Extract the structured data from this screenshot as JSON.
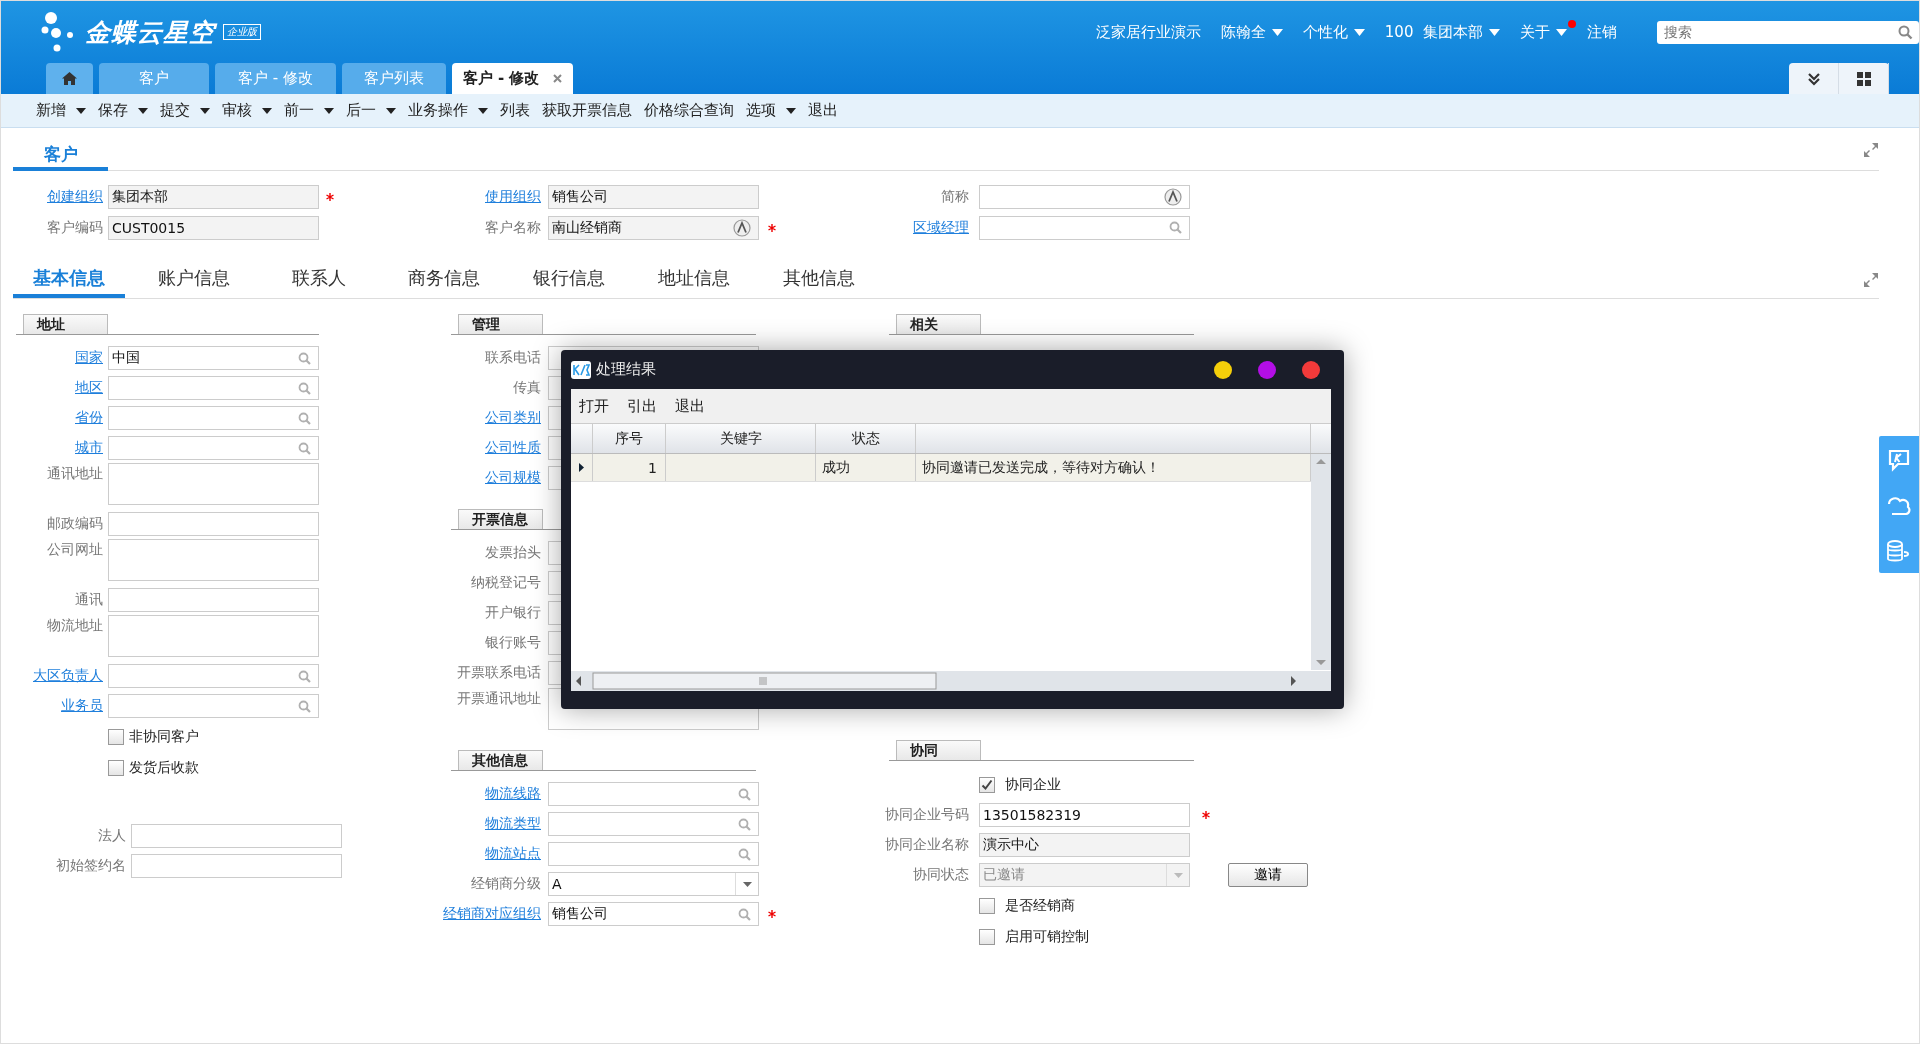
{
  "logo": {
    "name": "金蝶云星空",
    "edition": "企业版"
  },
  "user_menu": [
    {
      "label": "泛家居行业演示",
      "dropdown": false,
      "alert": false
    },
    {
      "label": "陈翰全",
      "dropdown": true,
      "alert": false
    },
    {
      "label": "个性化",
      "dropdown": true,
      "alert": false
    },
    {
      "label": "100  集团本部",
      "dropdown": true,
      "alert": false
    },
    {
      "label": "关于",
      "dropdown": true,
      "alert": true
    },
    {
      "label": "注销",
      "dropdown": false,
      "alert": false
    }
  ],
  "search": {
    "placeholder": "搜索"
  },
  "page_tabs": [
    {
      "kind": "home",
      "selected": false,
      "closable": false
    },
    {
      "kind": "tab",
      "label": "客户",
      "selected": false,
      "closable": false
    },
    {
      "kind": "tab",
      "label": "客户 - 修改",
      "selected": false,
      "closable": false
    },
    {
      "kind": "tab",
      "label": "客户列表",
      "selected": false,
      "closable": false
    },
    {
      "kind": "tab",
      "label": "客户 - 修改",
      "selected": true,
      "closable": true
    }
  ],
  "toolbar": [
    {
      "label": "新增",
      "dropdown": true
    },
    {
      "label": "保存",
      "dropdown": true
    },
    {
      "label": "提交",
      "dropdown": true
    },
    {
      "label": "审核",
      "dropdown": true
    },
    {
      "label": "前一",
      "dropdown": true
    },
    {
      "label": "后一",
      "dropdown": true
    },
    {
      "label": "业务操作",
      "dropdown": true
    },
    {
      "label": "列表",
      "dropdown": false
    },
    {
      "label": "获取开票信息",
      "dropdown": false
    },
    {
      "label": "价格综合查询",
      "dropdown": false
    },
    {
      "label": "选项",
      "dropdown": true
    },
    {
      "label": "退出",
      "dropdown": false
    }
  ],
  "form": {
    "title": "客户"
  },
  "header_fields": [
    [
      {
        "kind": "input",
        "label": "创建组织",
        "link": true,
        "value": "集团本部",
        "lookup": false,
        "multilingual": false,
        "required": true,
        "readonly": true
      },
      {
        "kind": "input",
        "label": "客户编码",
        "link": false,
        "value": "CUST0015",
        "lookup": false,
        "multilingual": false,
        "required": false,
        "readonly": true
      }
    ],
    [
      {
        "kind": "input",
        "label": "使用组织",
        "link": true,
        "value": "销售公司",
        "lookup": false,
        "multilingual": false,
        "required": false,
        "readonly": true
      },
      {
        "kind": "input",
        "label": "客户名称",
        "link": false,
        "value": "南山经销商",
        "lookup": false,
        "multilingual": true,
        "required": true,
        "readonly": true
      }
    ],
    [
      {
        "kind": "input",
        "label": "简称",
        "link": false,
        "lookup": false,
        "multilingual": true,
        "required": false,
        "readonly": false
      },
      {
        "kind": "input",
        "label": "区域经理",
        "link": true,
        "lookup": true,
        "multilingual": false,
        "required": false,
        "readonly": false
      }
    ]
  ],
  "detail_tabs": [
    {
      "label": "基本信息",
      "selected": true
    },
    {
      "label": "账户信息",
      "selected": false
    },
    {
      "label": "联系人",
      "selected": false
    },
    {
      "label": "商务信息",
      "selected": false
    },
    {
      "label": "银行信息",
      "selected": false
    },
    {
      "label": "地址信息",
      "selected": false
    },
    {
      "label": "其他信息",
      "selected": false
    }
  ],
  "columns": [
    [
      {
        "title": "地址",
        "rows": [
          {
            "kind": "input",
            "label": "国家",
            "link": true,
            "value": "中国",
            "lookup": true,
            "multilingual": false,
            "required": false,
            "readonly": false
          },
          {
            "kind": "input",
            "label": "地区",
            "link": true,
            "lookup": true,
            "multilingual": false,
            "required": false,
            "readonly": false
          },
          {
            "kind": "input",
            "label": "省份",
            "link": true,
            "lookup": true,
            "multilingual": false,
            "required": false,
            "readonly": false
          },
          {
            "kind": "input",
            "label": "城市",
            "link": true,
            "lookup": true,
            "multilingual": false,
            "required": false,
            "readonly": false
          },
          {
            "kind": "textarea",
            "label": "通讯地址",
            "link": false,
            "required": false,
            "readonly": false
          },
          {
            "kind": "input",
            "label": "邮政编码",
            "link": false,
            "lookup": false,
            "multilingual": false,
            "required": false,
            "readonly": false
          },
          {
            "kind": "textarea",
            "label": "公司网址",
            "link": false,
            "required": false,
            "readonly": false
          },
          {
            "kind": "input",
            "label": "通讯",
            "link": false,
            "lookup": false,
            "multilingual": false,
            "required": false,
            "readonly": false
          },
          {
            "kind": "textarea",
            "label": "物流地址",
            "link": false,
            "required": false,
            "readonly": false
          },
          {
            "kind": "input",
            "label": "大区负责人",
            "link": true,
            "lookup": true,
            "multilingual": false,
            "required": false,
            "readonly": false
          },
          {
            "kind": "input",
            "label": "业务员",
            "link": true,
            "lookup": true,
            "multilingual": false,
            "required": false,
            "readonly": false
          },
          {
            "kind": "checkbox",
            "label": "非协同客户",
            "checked": false
          },
          {
            "kind": "checkbox",
            "label": "发货后收款",
            "checked": false
          }
        ]
      },
      {
        "rows": [
          {
            "kind": "input",
            "label": "法人",
            "link": false,
            "lookup": false,
            "multilingual": false,
            "required": false,
            "readonly": false
          },
          {
            "kind": "input",
            "label": "初始签约名",
            "link": false,
            "lookup": false,
            "multilingual": false,
            "required": false,
            "readonly": false
          }
        ]
      }
    ],
    [
      {
        "title": "管理",
        "rows": [
          {
            "kind": "input",
            "label": "联系电话",
            "link": false,
            "lookup": false,
            "multilingual": false,
            "required": false,
            "readonly": false
          },
          {
            "kind": "input",
            "label": "传真",
            "link": false,
            "lookup": false,
            "multilingual": false,
            "required": false,
            "readonly": false
          },
          {
            "kind": "input",
            "label": "公司类别",
            "link": true,
            "lookup": false,
            "multilingual": false,
            "required": false,
            "readonly": false
          },
          {
            "kind": "input",
            "label": "公司性质",
            "link": true,
            "lookup": false,
            "multilingual": false,
            "required": false,
            "readonly": false
          },
          {
            "kind": "input",
            "label": "公司规模",
            "link": true,
            "lookup": false,
            "multilingual": false,
            "required": false,
            "readonly": false
          }
        ]
      },
      {
        "title": "开票信息",
        "rows": [
          {
            "kind": "input",
            "label": "发票抬头",
            "link": false,
            "lookup": false,
            "multilingual": false,
            "required": false,
            "readonly": false
          },
          {
            "kind": "input",
            "label": "纳税登记号",
            "link": false,
            "lookup": false,
            "multilingual": false,
            "required": false,
            "readonly": false
          },
          {
            "kind": "input",
            "label": "开户银行",
            "link": false,
            "lookup": false,
            "multilingual": false,
            "required": false,
            "readonly": false
          },
          {
            "kind": "input",
            "label": "银行账号",
            "link": false,
            "lookup": false,
            "multilingual": false,
            "required": false,
            "readonly": false
          },
          {
            "kind": "input",
            "label": "开票联系电话",
            "link": false,
            "lookup": false,
            "multilingual": false,
            "required": false,
            "readonly": false
          },
          {
            "kind": "textarea",
            "label": "开票通讯地址",
            "link": false,
            "required": false,
            "readonly": false
          }
        ]
      },
      {
        "title": "其他信息",
        "rows": [
          {
            "kind": "input",
            "label": "物流线路",
            "link": true,
            "lookup": true,
            "multilingual": false,
            "required": false,
            "readonly": false
          },
          {
            "kind": "input",
            "label": "物流类型",
            "link": true,
            "lookup": true,
            "multilingual": false,
            "required": false,
            "readonly": false
          },
          {
            "kind": "input",
            "label": "物流站点",
            "link": true,
            "lookup": true,
            "multilingual": false,
            "required": false,
            "readonly": false
          },
          {
            "kind": "select",
            "label": "经销商分级",
            "link": false,
            "value": "A",
            "required": false,
            "readonly": false
          },
          {
            "kind": "input",
            "label": "经销商对应组织",
            "link": true,
            "value": "销售公司",
            "lookup": true,
            "multilingual": false,
            "required": true,
            "readonly": false
          }
        ]
      }
    ],
    [
      {
        "title": "相关"
      },
      {
        "title": "协同",
        "rows": [
          {
            "kind": "checkbox",
            "label": "协同企业",
            "checked": true
          },
          {
            "kind": "input",
            "label": "协同企业号码",
            "link": false,
            "value": "13501582319",
            "lookup": false,
            "multilingual": false,
            "required": true,
            "readonly": false
          },
          {
            "kind": "input",
            "label": "协同企业名称",
            "link": false,
            "value": "演示中心",
            "lookup": false,
            "multilingual": false,
            "required": false,
            "readonly": true
          },
          {
            "kind": "select",
            "label": "协同状态",
            "link": false,
            "value": "已邀请",
            "required": false,
            "readonly": true,
            "action": "邀请"
          },
          {
            "kind": "checkbox",
            "label": "是否经销商",
            "checked": false
          },
          {
            "kind": "checkbox",
            "label": "启用可销控制",
            "checked": false
          }
        ]
      }
    ]
  ],
  "dialog": {
    "title": "处理结果",
    "window_buttons": [
      {
        "color": "#f5cf0a"
      },
      {
        "color": "#b30ee6"
      },
      {
        "color": "#f23a3a"
      }
    ],
    "menu": [
      "打开",
      "引出",
      "退出"
    ],
    "columns": [
      "序号",
      "关键字",
      "状态"
    ],
    "rows": [
      {
        "index": "1",
        "status": "成功",
        "message": "协同邀请已发送完成，等待对方确认！",
        "selected": true
      }
    ]
  }
}
